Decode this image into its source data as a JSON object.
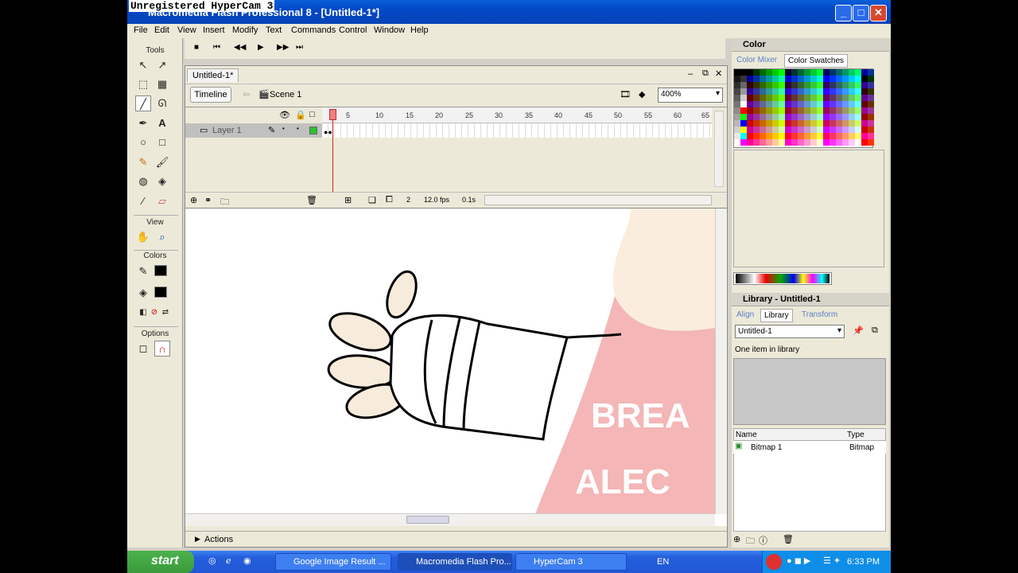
{
  "window": {
    "watermark": "Unregistered HyperCam 3",
    "title": "Macromedia Flash Professional 8 - [Untitled-1*]"
  },
  "menu": [
    "File",
    "Edit",
    "View",
    "Insert",
    "Modify",
    "Text",
    "Commands",
    "Control",
    "Window",
    "Help"
  ],
  "toolbox": {
    "tools_label": "Tools",
    "view_label": "View",
    "colors_label": "Colors",
    "options_label": "Options"
  },
  "document": {
    "tab": "Untitled-1*",
    "timeline_button": "Timeline",
    "scene": "Scene 1",
    "zoom": "400%"
  },
  "timeline": {
    "layer_name": "Layer 1",
    "ruler_numbers": [
      "5",
      "10",
      "15",
      "20",
      "25",
      "30",
      "35",
      "40",
      "45",
      "50",
      "55",
      "60",
      "65"
    ],
    "current_frame": "2",
    "fps": "12.0 fps",
    "time": "0.1s"
  },
  "stage": {
    "shirt_text_1": "BREA",
    "shirt_text_2": "ALEC"
  },
  "actions_panel": {
    "label": "Actions"
  },
  "color_panel": {
    "title": "Color",
    "tab_mixer": "Color Mixer",
    "tab_swatches": "Color Swatches"
  },
  "library_panel": {
    "title": "Library - Untitled-1",
    "tab_align": "Align",
    "tab_library": "Library",
    "tab_transform": "Transform",
    "document": "Untitled-1",
    "item_count": "One item in library",
    "col_name": "Name",
    "col_type": "Type",
    "items": [
      {
        "name": "Bitmap 1",
        "type": "Bitmap"
      }
    ]
  },
  "taskbar": {
    "start": "start",
    "tasks": [
      "Google Image Result ...",
      "Macromedia Flash Pro...",
      "HyperCam 3"
    ],
    "language": "EN",
    "clock": "6:33 PM"
  },
  "colors": {
    "titlebar": "#0348c5",
    "taskbar": "#245edb",
    "start": "#3a9b3a"
  }
}
